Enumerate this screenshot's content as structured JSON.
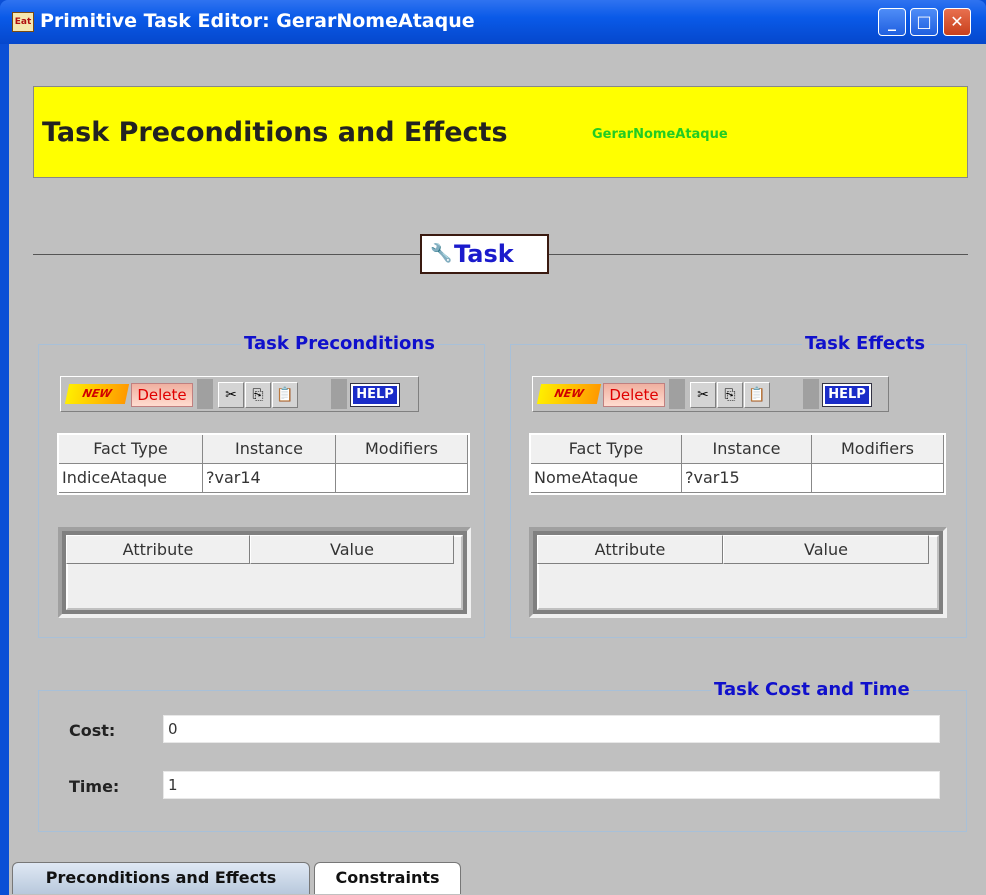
{
  "window": {
    "title": "Primitive Task Editor: GerarNomeAtaque",
    "app_icon": "app-icon",
    "minimize_label": "_",
    "maximize_label": "□",
    "close_label": "✕"
  },
  "banner": {
    "title": "Task Preconditions and Effects",
    "subtitle": "GerarNomeAtaque",
    "background": "#ffff00",
    "subtitle_color": "#22cc22"
  },
  "section": {
    "label": "Task",
    "icon": "wrench-icon"
  },
  "toolbar": {
    "new_label": "NEW",
    "delete_label": "Delete",
    "cut_icon": "cut-icon",
    "copy_icon": "copy-icon",
    "paste_icon": "paste-icon",
    "help_label": "HELP"
  },
  "preconditions": {
    "title": "Task Preconditions",
    "columns": [
      "Fact Type",
      "Instance",
      "Modifiers"
    ],
    "rows": [
      [
        "IndiceAtaque",
        "?var14",
        ""
      ]
    ],
    "attr_columns": [
      "Attribute",
      "Value"
    ]
  },
  "effects": {
    "title": "Task Effects",
    "columns": [
      "Fact Type",
      "Instance",
      "Modifiers"
    ],
    "rows": [
      [
        "NomeAtaque",
        "?var15",
        ""
      ]
    ],
    "attr_columns": [
      "Attribute",
      "Value"
    ]
  },
  "cost_time": {
    "title": "Task Cost and Time",
    "cost_label": "Cost:",
    "cost_value": "0",
    "time_label": "Time:",
    "time_value": "1"
  },
  "tabs": [
    {
      "label": "Preconditions and Effects",
      "active": true
    },
    {
      "label": "Constraints",
      "active": false
    }
  ],
  "colors": {
    "title_blue": "#1010cc",
    "panel_bg": "#c0c0c0"
  }
}
